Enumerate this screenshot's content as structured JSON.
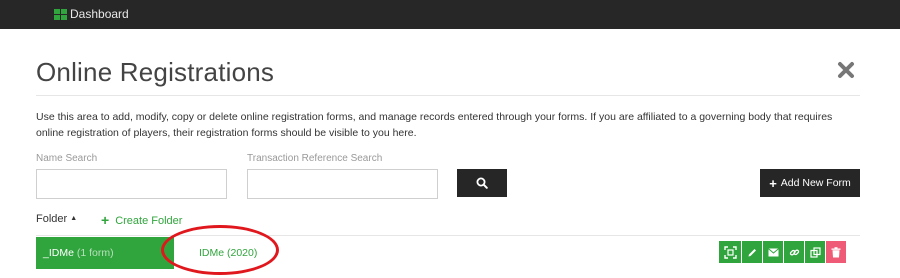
{
  "topbar": {
    "dashboard_label": "Dashboard"
  },
  "page": {
    "title": "Online Registrations",
    "description": "Use this area to add, modify, copy or delete online registration forms, and manage records entered through your forms. If you are affiliated to a governing body that requires online registration of players, their registration forms should be visible to you here."
  },
  "search": {
    "name_label": "Name Search",
    "name_value": "",
    "transaction_label": "Transaction Reference Search",
    "transaction_value": ""
  },
  "toolbar": {
    "add_form_label": "Add New Form"
  },
  "folders": {
    "sort_label": "Folder",
    "create_label": "Create Folder",
    "items": [
      {
        "name": "_IDMe",
        "count": "(1 form)"
      }
    ]
  },
  "forms": [
    {
      "name": "IDMe (2020)"
    }
  ],
  "row_actions": [
    "preview-icon",
    "edit-icon",
    "email-icon",
    "link-icon",
    "copy-icon",
    "delete-icon"
  ],
  "colors": {
    "accent": "#31a53d",
    "danger": "#ef5a77",
    "topbar": "#272727",
    "annotation": "#e0181e"
  }
}
